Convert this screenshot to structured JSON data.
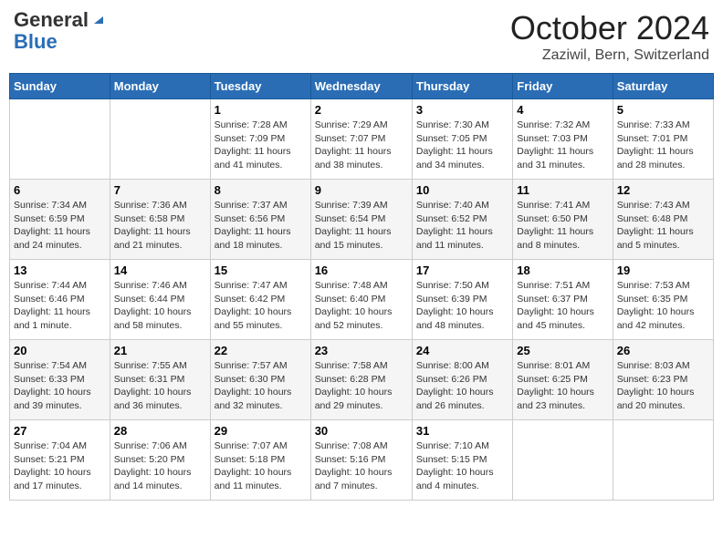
{
  "header": {
    "logo_general": "General",
    "logo_blue": "Blue",
    "month_title": "October 2024",
    "location": "Zaziwil, Bern, Switzerland"
  },
  "days_of_week": [
    "Sunday",
    "Monday",
    "Tuesday",
    "Wednesday",
    "Thursday",
    "Friday",
    "Saturday"
  ],
  "weeks": [
    [
      {
        "day": "",
        "info": ""
      },
      {
        "day": "",
        "info": ""
      },
      {
        "day": "1",
        "info": "Sunrise: 7:28 AM\nSunset: 7:09 PM\nDaylight: 11 hours and 41 minutes."
      },
      {
        "day": "2",
        "info": "Sunrise: 7:29 AM\nSunset: 7:07 PM\nDaylight: 11 hours and 38 minutes."
      },
      {
        "day": "3",
        "info": "Sunrise: 7:30 AM\nSunset: 7:05 PM\nDaylight: 11 hours and 34 minutes."
      },
      {
        "day": "4",
        "info": "Sunrise: 7:32 AM\nSunset: 7:03 PM\nDaylight: 11 hours and 31 minutes."
      },
      {
        "day": "5",
        "info": "Sunrise: 7:33 AM\nSunset: 7:01 PM\nDaylight: 11 hours and 28 minutes."
      }
    ],
    [
      {
        "day": "6",
        "info": "Sunrise: 7:34 AM\nSunset: 6:59 PM\nDaylight: 11 hours and 24 minutes."
      },
      {
        "day": "7",
        "info": "Sunrise: 7:36 AM\nSunset: 6:58 PM\nDaylight: 11 hours and 21 minutes."
      },
      {
        "day": "8",
        "info": "Sunrise: 7:37 AM\nSunset: 6:56 PM\nDaylight: 11 hours and 18 minutes."
      },
      {
        "day": "9",
        "info": "Sunrise: 7:39 AM\nSunset: 6:54 PM\nDaylight: 11 hours and 15 minutes."
      },
      {
        "day": "10",
        "info": "Sunrise: 7:40 AM\nSunset: 6:52 PM\nDaylight: 11 hours and 11 minutes."
      },
      {
        "day": "11",
        "info": "Sunrise: 7:41 AM\nSunset: 6:50 PM\nDaylight: 11 hours and 8 minutes."
      },
      {
        "day": "12",
        "info": "Sunrise: 7:43 AM\nSunset: 6:48 PM\nDaylight: 11 hours and 5 minutes."
      }
    ],
    [
      {
        "day": "13",
        "info": "Sunrise: 7:44 AM\nSunset: 6:46 PM\nDaylight: 11 hours and 1 minute."
      },
      {
        "day": "14",
        "info": "Sunrise: 7:46 AM\nSunset: 6:44 PM\nDaylight: 10 hours and 58 minutes."
      },
      {
        "day": "15",
        "info": "Sunrise: 7:47 AM\nSunset: 6:42 PM\nDaylight: 10 hours and 55 minutes."
      },
      {
        "day": "16",
        "info": "Sunrise: 7:48 AM\nSunset: 6:40 PM\nDaylight: 10 hours and 52 minutes."
      },
      {
        "day": "17",
        "info": "Sunrise: 7:50 AM\nSunset: 6:39 PM\nDaylight: 10 hours and 48 minutes."
      },
      {
        "day": "18",
        "info": "Sunrise: 7:51 AM\nSunset: 6:37 PM\nDaylight: 10 hours and 45 minutes."
      },
      {
        "day": "19",
        "info": "Sunrise: 7:53 AM\nSunset: 6:35 PM\nDaylight: 10 hours and 42 minutes."
      }
    ],
    [
      {
        "day": "20",
        "info": "Sunrise: 7:54 AM\nSunset: 6:33 PM\nDaylight: 10 hours and 39 minutes."
      },
      {
        "day": "21",
        "info": "Sunrise: 7:55 AM\nSunset: 6:31 PM\nDaylight: 10 hours and 36 minutes."
      },
      {
        "day": "22",
        "info": "Sunrise: 7:57 AM\nSunset: 6:30 PM\nDaylight: 10 hours and 32 minutes."
      },
      {
        "day": "23",
        "info": "Sunrise: 7:58 AM\nSunset: 6:28 PM\nDaylight: 10 hours and 29 minutes."
      },
      {
        "day": "24",
        "info": "Sunrise: 8:00 AM\nSunset: 6:26 PM\nDaylight: 10 hours and 26 minutes."
      },
      {
        "day": "25",
        "info": "Sunrise: 8:01 AM\nSunset: 6:25 PM\nDaylight: 10 hours and 23 minutes."
      },
      {
        "day": "26",
        "info": "Sunrise: 8:03 AM\nSunset: 6:23 PM\nDaylight: 10 hours and 20 minutes."
      }
    ],
    [
      {
        "day": "27",
        "info": "Sunrise: 7:04 AM\nSunset: 5:21 PM\nDaylight: 10 hours and 17 minutes."
      },
      {
        "day": "28",
        "info": "Sunrise: 7:06 AM\nSunset: 5:20 PM\nDaylight: 10 hours and 14 minutes."
      },
      {
        "day": "29",
        "info": "Sunrise: 7:07 AM\nSunset: 5:18 PM\nDaylight: 10 hours and 11 minutes."
      },
      {
        "day": "30",
        "info": "Sunrise: 7:08 AM\nSunset: 5:16 PM\nDaylight: 10 hours and 7 minutes."
      },
      {
        "day": "31",
        "info": "Sunrise: 7:10 AM\nSunset: 5:15 PM\nDaylight: 10 hours and 4 minutes."
      },
      {
        "day": "",
        "info": ""
      },
      {
        "day": "",
        "info": ""
      }
    ]
  ]
}
